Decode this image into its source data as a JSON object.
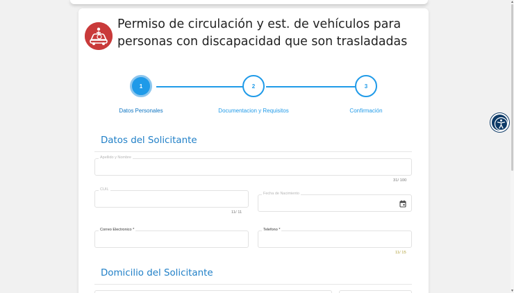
{
  "form": {
    "title": "Permiso de circulación y est. de vehículos para personas con discapacidad que son trasladadas",
    "logo_icon": "accessibility-car-icon",
    "brand_color": "#c93a3a",
    "accent_color": "#1f9ae8"
  },
  "stepper": {
    "steps": [
      {
        "number": "1",
        "label": "Datos Personales",
        "active": true
      },
      {
        "number": "2",
        "label": "Documentacion y Requisitos",
        "active": false
      },
      {
        "number": "3",
        "label": "Confirmación",
        "active": false
      }
    ]
  },
  "solicitante": {
    "section_title": "Datos del Solicitante",
    "apellido": {
      "label": "Apellido y Nombre",
      "value": "",
      "counter": "31/ 100"
    },
    "cuil": {
      "label": "CUIL",
      "value": "",
      "counter": "11/ 11"
    },
    "fecha": {
      "label": "Fecha de Nacimiento",
      "value": "",
      "icon": "calendar-icon"
    },
    "correo": {
      "label": "Correo Electronico *",
      "value": ""
    },
    "telefono": {
      "label": "Telefono *",
      "value": "",
      "counter": "11/ 15"
    }
  },
  "domicilio": {
    "section_title": "Domicilio del Solicitante"
  },
  "accessibility_button": {
    "icon": "accessibility-icon",
    "color": "#0d3a67"
  }
}
